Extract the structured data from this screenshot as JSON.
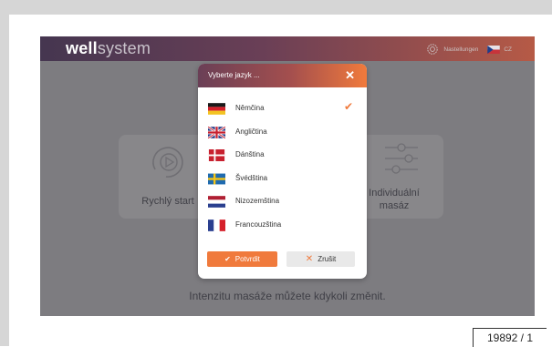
{
  "brand": {
    "bold": "well",
    "rest": "system"
  },
  "header": {
    "settings_label": "Nastellungen",
    "language_code": "CZ",
    "settings_icon": "gear-icon",
    "language_flag": "flag-cz"
  },
  "tiles": {
    "quick_start": "Rychlý start",
    "individual_line1": "Individuální",
    "individual_line2": "masáz"
  },
  "hint": "Intenzitu masáže můžete kdykoli změnit.",
  "modal": {
    "title": "Vyberte jazyk ...",
    "close_symbol": "✕",
    "languages": [
      {
        "label": "Němčina",
        "flag": "flag-de",
        "selected": true
      },
      {
        "label": "Angličtina",
        "flag": "flag-gb",
        "selected": false
      },
      {
        "label": "Dánština",
        "flag": "flag-dk",
        "selected": false
      },
      {
        "label": "Švédština",
        "flag": "flag-se",
        "selected": false
      },
      {
        "label": "Nizozemština",
        "flag": "flag-nl",
        "selected": false
      },
      {
        "label": "Francouzština",
        "flag": "flag-fr",
        "selected": false
      }
    ],
    "check_symbol": "✔",
    "confirm_label": "Potvrdit",
    "cancel_label": "Zrušit",
    "cancel_symbol": "✕"
  },
  "figure_number": "19892 / 1",
  "colors": {
    "accent": "#f07a3c",
    "overlay": "#7d7c80",
    "header_start": "#453650",
    "header_end": "#b65a46"
  }
}
